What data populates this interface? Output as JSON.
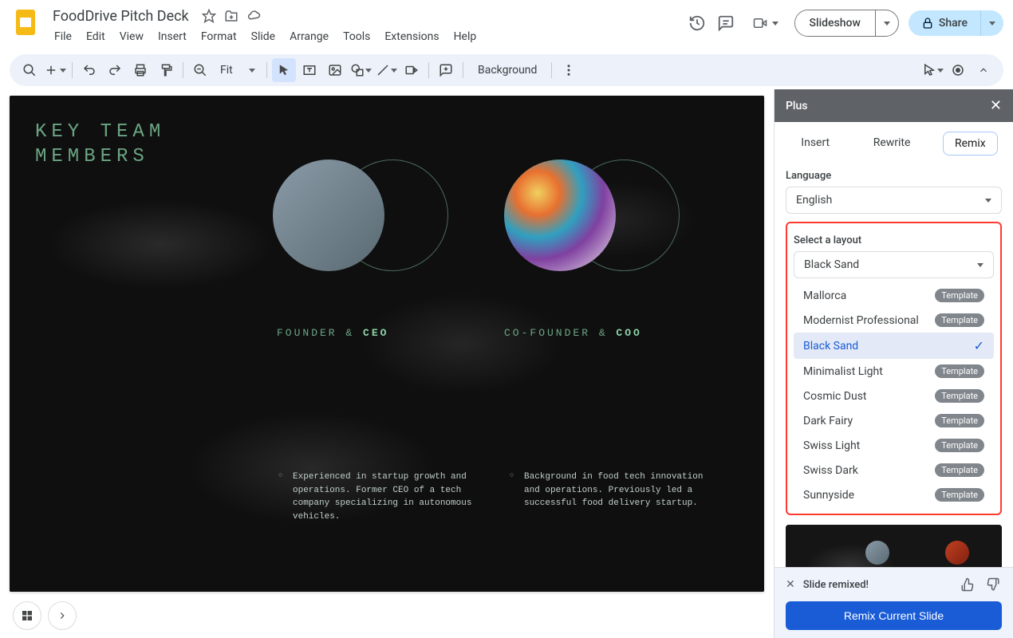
{
  "doc_title": "FoodDrive Pitch Deck",
  "menus": [
    "File",
    "Edit",
    "View",
    "Insert",
    "Format",
    "Slide",
    "Arrange",
    "Tools",
    "Extensions",
    "Help"
  ],
  "header_buttons": {
    "slideshow": "Slideshow",
    "share": "Share"
  },
  "toolbar": {
    "zoom": "Fit",
    "background": "Background"
  },
  "slide": {
    "title_line1": "KEY TEAM",
    "title_line2": "MEMBERS",
    "role1_prefix": "FOUNDER & ",
    "role1_bold": "CEO",
    "role2_prefix": "CO-FOUNDER & ",
    "role2_bold": "COO",
    "desc1": "Experienced in startup growth and operations. Former CEO of a tech company specializing in autonomous vehicles.",
    "desc2": "Background in food tech innovation and operations. Previously led a successful food delivery startup."
  },
  "panel": {
    "title": "Plus",
    "tabs": [
      "Insert",
      "Rewrite",
      "Remix"
    ],
    "active_tab": "Remix",
    "language_label": "Language",
    "language_value": "English",
    "layout_label": "Select a layout",
    "layout_value": "Black Sand",
    "layouts": [
      {
        "name": "Mallorca",
        "template": true,
        "selected": false
      },
      {
        "name": "Modernist Professional",
        "template": true,
        "selected": false
      },
      {
        "name": "Black Sand",
        "template": false,
        "selected": true
      },
      {
        "name": "Minimalist Light",
        "template": true,
        "selected": false
      },
      {
        "name": "Cosmic Dust",
        "template": true,
        "selected": false
      },
      {
        "name": "Dark Fairy",
        "template": true,
        "selected": false
      },
      {
        "name": "Swiss Light",
        "template": true,
        "selected": false
      },
      {
        "name": "Swiss Dark",
        "template": true,
        "selected": false
      },
      {
        "name": "Sunnyside",
        "template": true,
        "selected": false
      }
    ],
    "template_badge": "Template",
    "status": "Slide remixed!",
    "remix_button": "Remix Current Slide"
  }
}
